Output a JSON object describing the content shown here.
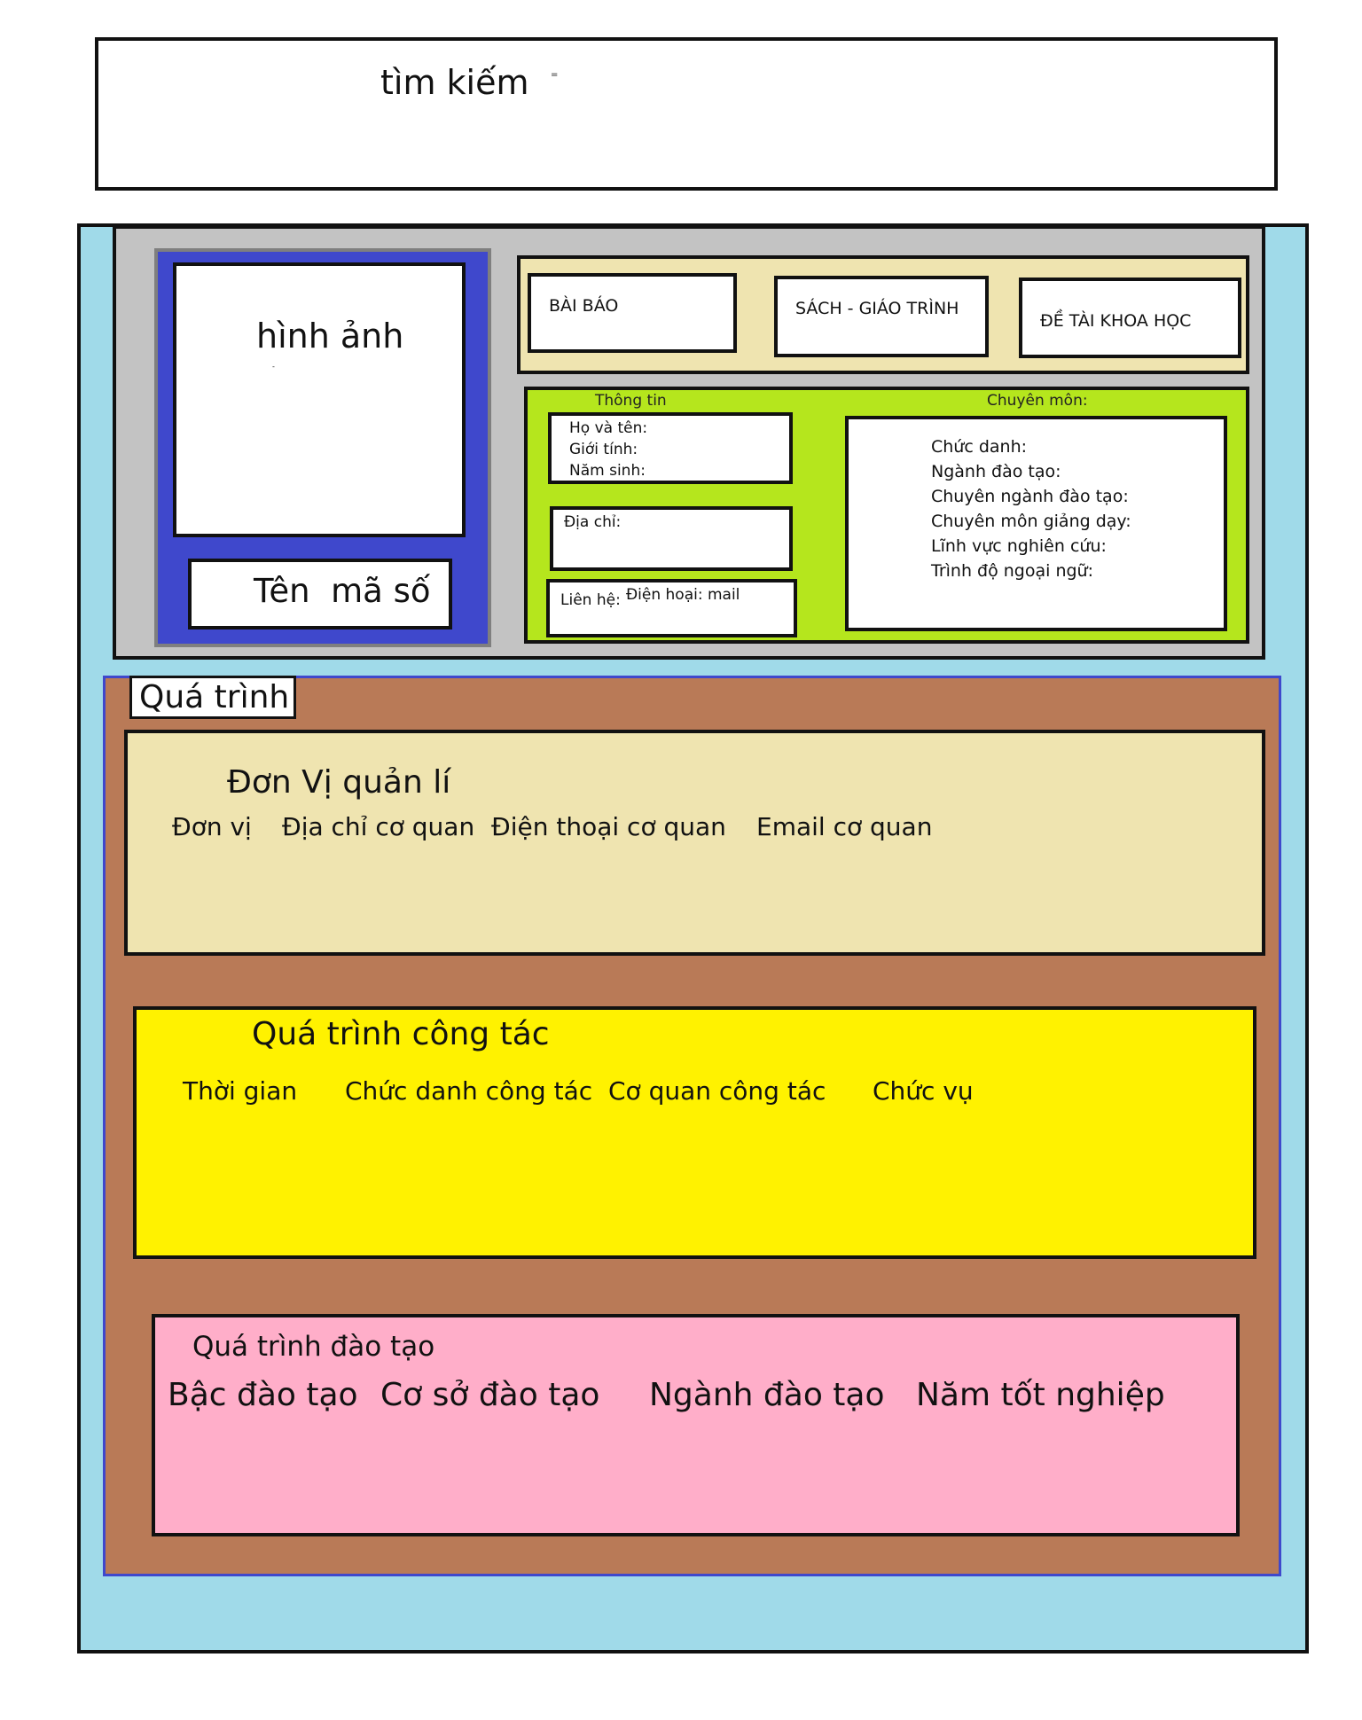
{
  "search": {
    "label": "tìm kiếm",
    "mark": "="
  },
  "profile": {
    "image_label": "hình ảnh",
    "image_mark": "-",
    "name_label": "Tên  mã số"
  },
  "tabs": [
    {
      "label": "BÀI BÁO"
    },
    {
      "label": "SÁCH - GIÁO TRÌNH"
    },
    {
      "label": "ĐỀ TÀI KHOA HỌC"
    }
  ],
  "info": {
    "caption": "Thông tin",
    "personal": [
      "Họ và tên:",
      "Giới tính:",
      "Năm sinh:"
    ],
    "address": "Địa chỉ:",
    "contact_label": "Liên hệ:",
    "contact_value": "Điện hoại: mail"
  },
  "specialty": {
    "caption": "Chuyên môn:",
    "fields": [
      "Chức danh:",
      "Ngành đào tạo:",
      "Chuyên ngành đào tạo:",
      "Chuyên môn giảng dạy:",
      "Lĩnh vực nghiên cứu:",
      "Trình độ ngoại ngữ:"
    ]
  },
  "process": {
    "title": "Quá trình",
    "unit": {
      "title": "Đơn Vị quản lí",
      "columns": [
        "Đơn vị",
        "Địa chỉ cơ quan",
        "Điện thoại cơ quan",
        "Email cơ quan"
      ]
    },
    "work": {
      "title": "Quá trình công tác",
      "columns": [
        "Thời gian",
        "Chức danh công tác",
        "Cơ quan công tác",
        "Chức vụ"
      ]
    },
    "education": {
      "title": "Quá trình đào tạo",
      "columns": [
        "Bậc đào tạo",
        "Cơ sở đào tạo",
        "Ngành đào tạo",
        "Năm tốt nghiệp"
      ]
    }
  },
  "colors": {
    "outer_frame": "#a0dae9",
    "profile_panel": "#c3c3c3",
    "left_card": "#3f48cc",
    "tabs_bar": "#efe4b0",
    "info_panel": "#b5e61d",
    "process_section": "#b97a57",
    "unit_section": "#efe4b0",
    "work_section": "#fff200",
    "education_section": "#ffaec9"
  }
}
